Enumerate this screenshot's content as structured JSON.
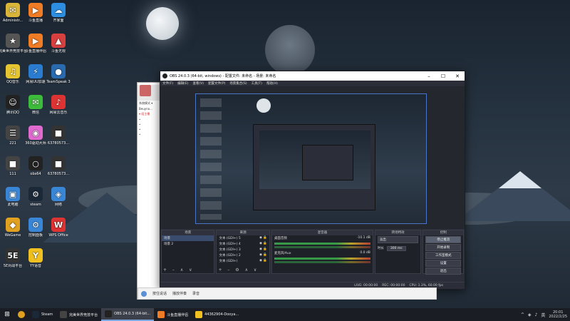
{
  "desktop": {
    "icons": [
      {
        "label": "Administr...",
        "glyph": "✉",
        "color": "#d9b53a"
      },
      {
        "label": "斗鱼直播",
        "glyph": "▶",
        "color": "#f07c25"
      },
      {
        "label": "齐家面",
        "glyph": "☁",
        "color": "#2d8de0"
      },
      {
        "label": "完美世界竞技平台",
        "glyph": "★",
        "color": "#555"
      },
      {
        "label": "斗鱼直播伴侣",
        "glyph": "▶",
        "color": "#f07c25"
      },
      {
        "label": "斗鱼无限",
        "glyph": "▲",
        "color": "#d84040"
      },
      {
        "label": "QQ音乐",
        "glyph": "♫",
        "color": "#e5c530"
      },
      {
        "label": "网易UU加速",
        "glyph": "⚡",
        "color": "#2a7cd0"
      },
      {
        "label": "TeamSpeak 3",
        "glyph": "●",
        "color": "#2a6bb0"
      },
      {
        "label": "腾讯QQ",
        "glyph": "☺",
        "color": "#222"
      },
      {
        "label": "微信",
        "glyph": "✉",
        "color": "#3dbb3a"
      },
      {
        "label": "网易云音乐",
        "glyph": "♪",
        "color": "#d33"
      },
      {
        "label": "221",
        "glyph": "☰",
        "color": "#444"
      },
      {
        "label": "360驱动大师",
        "glyph": "◉",
        "color": "#e06ad0"
      },
      {
        "label": "63780573...",
        "glyph": "■",
        "color": "#333"
      },
      {
        "label": "111",
        "glyph": "■",
        "color": "#444"
      },
      {
        "label": "obs64",
        "glyph": "○",
        "color": "#222"
      },
      {
        "label": "63780573...",
        "glyph": "■",
        "color": "#333"
      },
      {
        "label": "此电脑",
        "glyph": "▣",
        "color": "#3a86d6"
      },
      {
        "label": "steam",
        "glyph": "⚙",
        "color": "#1b2838"
      },
      {
        "label": "网络",
        "glyph": "◈",
        "color": "#3a86d6"
      },
      {
        "label": "WeGame",
        "glyph": "◆",
        "color": "#e0a020"
      },
      {
        "label": "控制面板",
        "glyph": "⚙",
        "color": "#3a86d6"
      },
      {
        "label": "WPS Office",
        "glyph": "W",
        "color": "#d33"
      },
      {
        "label": "5E对战平台",
        "glyph": "5E",
        "color": "#333"
      },
      {
        "label": "YY语音",
        "glyph": "Y",
        "color": "#f0c020"
      }
    ]
  },
  "bg_app": {
    "rows": [
      "系统模式 ▾",
      "Beuyno...",
      "▾ 组主播",
      "•",
      "•",
      "•",
      "•"
    ]
  },
  "obs": {
    "title": "OBS 24.0.3 (64-bit, windows) - 配置文件: 未命名 - 场景: 未命名",
    "menu": [
      "文件(F)",
      "编辑(E)",
      "查看(V)",
      "配置文件(P)",
      "场景集合(S)",
      "工具(T)",
      "帮助(H)"
    ],
    "docks": {
      "scenes": {
        "header": "场景",
        "items": [
          "场景",
          "场景 2"
        ]
      },
      "sources": {
        "header": "来源",
        "items": [
          "文本 (GDI+) 5",
          "文本 (GDI+) 4",
          "文本 (GDI+) 3",
          "文本 (GDI+) 2",
          "文本 (GDI+)"
        ]
      },
      "mixer": {
        "header": "混音器",
        "channels": [
          {
            "name": "桌面音频",
            "level": "-10.1 dB"
          },
          {
            "name": "麦克风/Aux",
            "level": "0.0 dB"
          }
        ]
      },
      "transitions": {
        "header": "转场特效",
        "type": "淡出",
        "duration_label": "时长",
        "duration": "300 ms"
      },
      "controls": {
        "header": "控制",
        "buttons": [
          "停止推流",
          "开始录制",
          "工作室模式",
          "设置",
          "退出"
        ]
      }
    },
    "status": {
      "live": "LIVE: 00:00:00",
      "rec": "REC: 00:00:00",
      "cpu": "CPU: 1.3%, 60.00 fps"
    }
  },
  "chatbar": {
    "items": [
      "按住说话",
      "播放伴奏",
      "录音"
    ]
  },
  "taskbar": {
    "items": [
      {
        "label": "Steam",
        "active": false
      },
      {
        "label": "完美世界竞技平台",
        "active": false
      },
      {
        "label": "OBS 24.0.3 (64-bit...",
        "active": true
      },
      {
        "label": "斗鱼直播伴侣",
        "active": false
      },
      {
        "label": "44362904-Dooya...",
        "active": false
      }
    ],
    "time": "20:01",
    "date": "2022/2/25"
  }
}
